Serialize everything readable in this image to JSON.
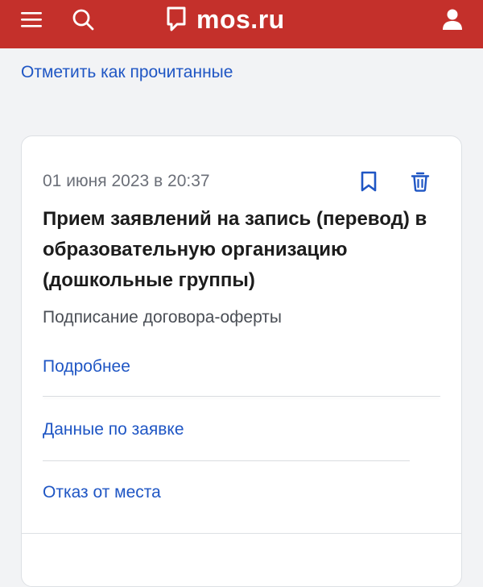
{
  "header": {
    "logo_text": "mos.ru",
    "brand_color": "#c4302b",
    "icons": [
      "menu-icon",
      "search-icon",
      "logo-mark-icon",
      "user-icon"
    ]
  },
  "notifications": {
    "mark_all_read": "Отметить как прочитанные"
  },
  "card": {
    "date": "01 июня 2023 в 20:37",
    "title": "Прием заявлений на запись (перевод) в образовательную организацию (дошкольные группы)",
    "status": "Подписание договора-оферты",
    "more_link": "Подробнее",
    "data_link": "Данные по заявке",
    "refuse_link": "Отказ от места",
    "icons": [
      "bookmark-icon",
      "trash-icon"
    ],
    "link_color": "#1f56c4"
  }
}
